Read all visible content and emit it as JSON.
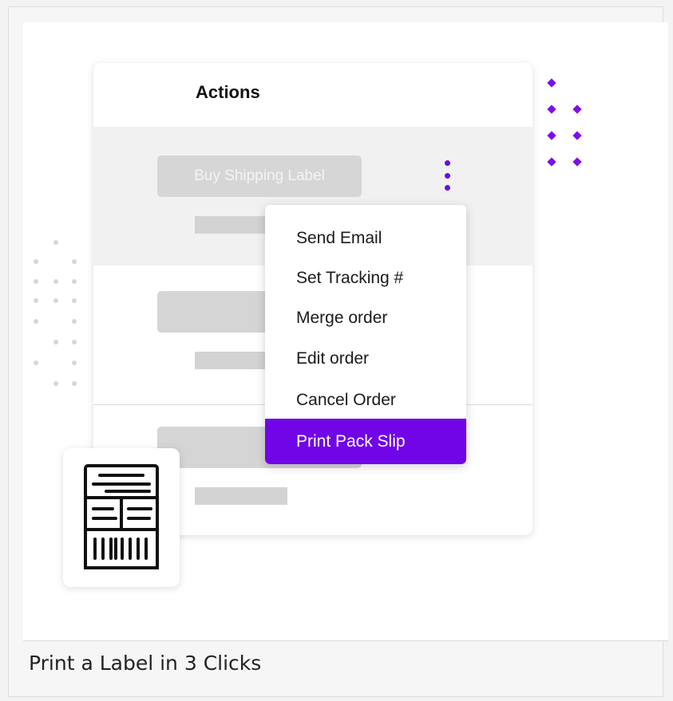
{
  "card": {
    "title": "Actions",
    "buy_button_label": "Buy Shipping Label"
  },
  "menu": {
    "items": [
      {
        "label": "Send Email"
      },
      {
        "label": "Set Tracking #"
      },
      {
        "label": "Merge order"
      },
      {
        "label": "Edit order"
      },
      {
        "label": "Cancel Order"
      },
      {
        "label": "Print Pack Slip"
      }
    ],
    "active_index": 5
  },
  "caption": "Print a Label in 3 Clicks",
  "icons": {
    "kebab": "more-vertical-icon",
    "label_tile": "shipping-label-icon"
  },
  "colors": {
    "accent": "#7105e8",
    "placeholder": "#d5d5d5"
  }
}
